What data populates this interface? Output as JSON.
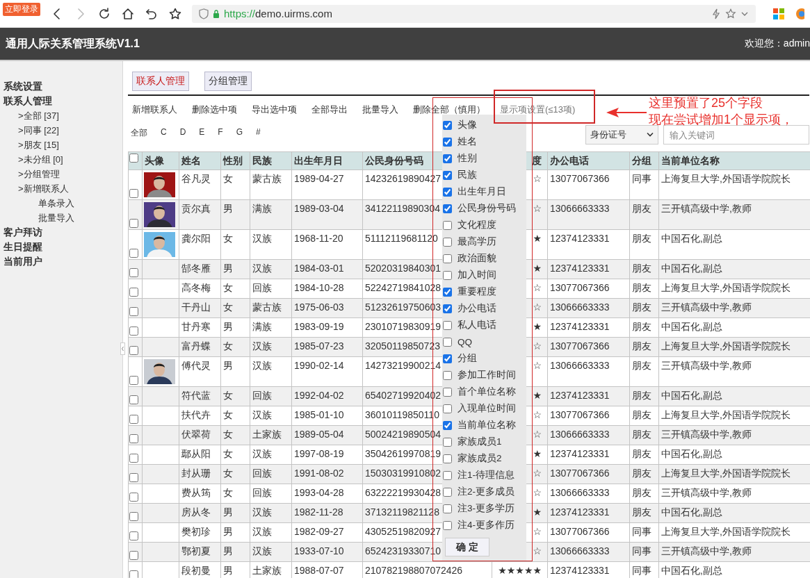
{
  "browser": {
    "badge": "立即登录",
    "url_scheme": "https://",
    "url_host": "demo.uirms.com"
  },
  "header": {
    "title": "通用人际关系管理系统V1.1",
    "welcome": "欢迎您：admin"
  },
  "sidebar": {
    "items": [
      {
        "label": "系统设置"
      },
      {
        "label": "联系人管理",
        "children": [
          {
            "label": ">全部 [37]"
          },
          {
            "label": ">同事 [22]"
          },
          {
            "label": ">朋友 [15]"
          },
          {
            "label": ">未分组 [0]"
          },
          {
            "label": ">分组管理"
          },
          {
            "label": ">新增联系人",
            "children": [
              {
                "label": "单条录入"
              },
              {
                "label": "批量导入"
              }
            ]
          }
        ]
      },
      {
        "label": "客户拜访"
      },
      {
        "label": "生日提醒"
      },
      {
        "label": "当前用户"
      }
    ]
  },
  "tabs": [
    {
      "label": "联系人管理",
      "selected": true
    },
    {
      "label": "分组管理",
      "selected": false
    }
  ],
  "toolbar": [
    "新增联系人",
    "删除选中项",
    "导出选中项",
    "全部导出",
    "批量导入",
    "删除全部（慎用）",
    "显示项设置(≤13项)"
  ],
  "letter_filter": [
    "全部",
    "C",
    "D",
    "E",
    "F",
    "G",
    "#"
  ],
  "search": {
    "field": "身份证号",
    "placeholder": "输入关键词"
  },
  "table": {
    "select_all_checked": false,
    "columns": [
      "头像",
      "姓名",
      "性别",
      "民族",
      "出生年月日",
      "公民身份号码",
      "度",
      "办公电话",
      "分组",
      "当前单位名称"
    ],
    "rows": [
      {
        "checked": false,
        "photo": true,
        "name": "谷凡灵",
        "gender": "女",
        "ethnicity": "蒙古族",
        "birth_date": "1989-04-27",
        "id_number": "14232619890427",
        "importance": "☆",
        "office_phone": "13077067366",
        "group": "同事",
        "employer": "上海复旦大学,外国语学院院长"
      },
      {
        "checked": false,
        "photo": true,
        "name": "贡尔真",
        "gender": "男",
        "ethnicity": "满族",
        "birth_date": "1989-03-04",
        "id_number": "34122119890304",
        "importance": "☆",
        "office_phone": "13066663333",
        "group": "朋友",
        "employer": "三开镇高级中学,教师"
      },
      {
        "checked": false,
        "photo": true,
        "name": "龚尔阳",
        "gender": "女",
        "ethnicity": "汉族",
        "birth_date": "1968-11-20",
        "id_number": "51112119681120",
        "importance": "★",
        "office_phone": "12374123331",
        "group": "朋友",
        "employer": "中国石化,副总"
      },
      {
        "checked": false,
        "photo": false,
        "name": "郜冬雁",
        "gender": "男",
        "ethnicity": "汉族",
        "birth_date": "1984-03-01",
        "id_number": "52020319840301",
        "importance": "★",
        "office_phone": "12374123331",
        "group": "朋友",
        "employer": "中国石化,副总"
      },
      {
        "checked": false,
        "photo": false,
        "name": "高冬梅",
        "gender": "女",
        "ethnicity": "回族",
        "birth_date": "1984-10-28",
        "id_number": "52242719841028",
        "importance": "☆",
        "office_phone": "13077067366",
        "group": "朋友",
        "employer": "上海复旦大学,外国语学院院长"
      },
      {
        "checked": false,
        "photo": false,
        "name": "干丹山",
        "gender": "女",
        "ethnicity": "蒙古族",
        "birth_date": "1975-06-03",
        "id_number": "51232619750603",
        "importance": "☆",
        "office_phone": "13066663333",
        "group": "朋友",
        "employer": "三开镇高级中学,教师"
      },
      {
        "checked": false,
        "photo": false,
        "name": "甘丹寒",
        "gender": "男",
        "ethnicity": "满族",
        "birth_date": "1983-09-19",
        "id_number": "23010719830919",
        "importance": "★",
        "office_phone": "12374123331",
        "group": "朋友",
        "employer": "中国石化,副总"
      },
      {
        "checked": false,
        "photo": false,
        "name": "富丹蝶",
        "gender": "女",
        "ethnicity": "汉族",
        "birth_date": "1985-07-23",
        "id_number": "32050119850723",
        "importance": "☆",
        "office_phone": "13077067366",
        "group": "朋友",
        "employer": "上海复旦大学,外国语学院院长"
      },
      {
        "checked": false,
        "photo": true,
        "name": "傅代灵",
        "gender": "男",
        "ethnicity": "汉族",
        "birth_date": "1990-02-14",
        "id_number": "14273219900214",
        "importance": "☆",
        "office_phone": "13066663333",
        "group": "朋友",
        "employer": "三开镇高级中学,教师"
      },
      {
        "checked": false,
        "photo": false,
        "name": "符代蓝",
        "gender": "女",
        "ethnicity": "回族",
        "birth_date": "1992-04-02",
        "id_number": "65402719920402",
        "importance": "★",
        "office_phone": "12374123331",
        "group": "朋友",
        "employer": "中国石化,副总"
      },
      {
        "checked": false,
        "photo": false,
        "name": "扶代卉",
        "gender": "女",
        "ethnicity": "汉族",
        "birth_date": "1985-01-10",
        "id_number": "36010119850110",
        "importance": "☆",
        "office_phone": "13077067366",
        "group": "朋友",
        "employer": "上海复旦大学,外国语学院院长"
      },
      {
        "checked": false,
        "photo": false,
        "name": "伏翠荷",
        "gender": "女",
        "ethnicity": "土家族",
        "birth_date": "1989-05-04",
        "id_number": "50024219890504",
        "importance": "☆",
        "office_phone": "13066663333",
        "group": "朋友",
        "employer": "三开镇高级中学,教师"
      },
      {
        "checked": false,
        "photo": false,
        "name": "鄢从阳",
        "gender": "女",
        "ethnicity": "汉族",
        "birth_date": "1997-08-19",
        "id_number": "35042619970819",
        "importance": "★",
        "office_phone": "12374123331",
        "group": "朋友",
        "employer": "中国石化,副总"
      },
      {
        "checked": false,
        "photo": false,
        "name": "封从珊",
        "gender": "女",
        "ethnicity": "回族",
        "birth_date": "1991-08-02",
        "id_number": "15030319910802",
        "importance": "☆",
        "office_phone": "13077067366",
        "group": "朋友",
        "employer": "上海复旦大学,外国语学院院长"
      },
      {
        "checked": false,
        "photo": false,
        "name": "费从筠",
        "gender": "女",
        "ethnicity": "回族",
        "birth_date": "1993-04-28",
        "id_number": "63222219930428",
        "importance": "☆",
        "office_phone": "13066663333",
        "group": "朋友",
        "employer": "三开镇高级中学,教师"
      },
      {
        "checked": false,
        "photo": false,
        "name": "房从冬",
        "gender": "男",
        "ethnicity": "汉族",
        "birth_date": "1982-11-28",
        "id_number": "37132119821128",
        "importance": "★",
        "office_phone": "12374123331",
        "group": "朋友",
        "employer": "中国石化,副总"
      },
      {
        "checked": false,
        "photo": false,
        "name": "樊初珍",
        "gender": "男",
        "ethnicity": "汉族",
        "birth_date": "1982-09-27",
        "id_number": "43052519820927",
        "importance": "☆",
        "office_phone": "13077067366",
        "group": "同事",
        "employer": "上海复旦大学,外国语学院院长"
      },
      {
        "checked": false,
        "photo": false,
        "name": "鄂初夏",
        "gender": "男",
        "ethnicity": "汉族",
        "birth_date": "1933-07-10",
        "id_number": "65242319330710",
        "importance": "☆",
        "office_phone": "13066663333",
        "group": "同事",
        "employer": "三开镇高级中学,教师"
      },
      {
        "checked": false,
        "photo": false,
        "name": "段初曼",
        "gender": "男",
        "ethnicity": "土家族",
        "birth_date": "1988-07-07",
        "id_number": "210782198807072426",
        "importance": "★★★★★",
        "office_phone": "12374123331",
        "group": "同事",
        "employer": "中国石化,副总"
      }
    ]
  },
  "column_picker": {
    "options": [
      {
        "label": "头像",
        "checked": true
      },
      {
        "label": "姓名",
        "checked": true
      },
      {
        "label": "性别",
        "checked": true
      },
      {
        "label": "民族",
        "checked": true
      },
      {
        "label": "出生年月日",
        "checked": true
      },
      {
        "label": "公民身份号码",
        "checked": true
      },
      {
        "label": "文化程度",
        "checked": false
      },
      {
        "label": "最高学历",
        "checked": false
      },
      {
        "label": "政治面貌",
        "checked": false
      },
      {
        "label": "加入时间",
        "checked": false
      },
      {
        "label": "重要程度",
        "checked": true
      },
      {
        "label": "办公电话",
        "checked": true
      },
      {
        "label": "私人电话",
        "checked": false
      },
      {
        "label": "QQ",
        "checked": false
      },
      {
        "label": "分组",
        "checked": true
      },
      {
        "label": "参加工作时间",
        "checked": false
      },
      {
        "label": "首个单位名称",
        "checked": false
      },
      {
        "label": "入现单位时间",
        "checked": false
      },
      {
        "label": "当前单位名称",
        "checked": true
      },
      {
        "label": "家族成员1",
        "checked": false
      },
      {
        "label": "家族成员2",
        "checked": false
      },
      {
        "label": "注1-待理信息",
        "checked": false
      },
      {
        "label": "注2-更多成员",
        "checked": false
      },
      {
        "label": "注3-更多学历",
        "checked": false
      },
      {
        "label": "注4-更多作历",
        "checked": false
      }
    ],
    "confirm": "确 定"
  },
  "annotation": {
    "lines": [
      "这里预置了25个字段",
      "现在尝试增加1个显示项，"
    ]
  }
}
